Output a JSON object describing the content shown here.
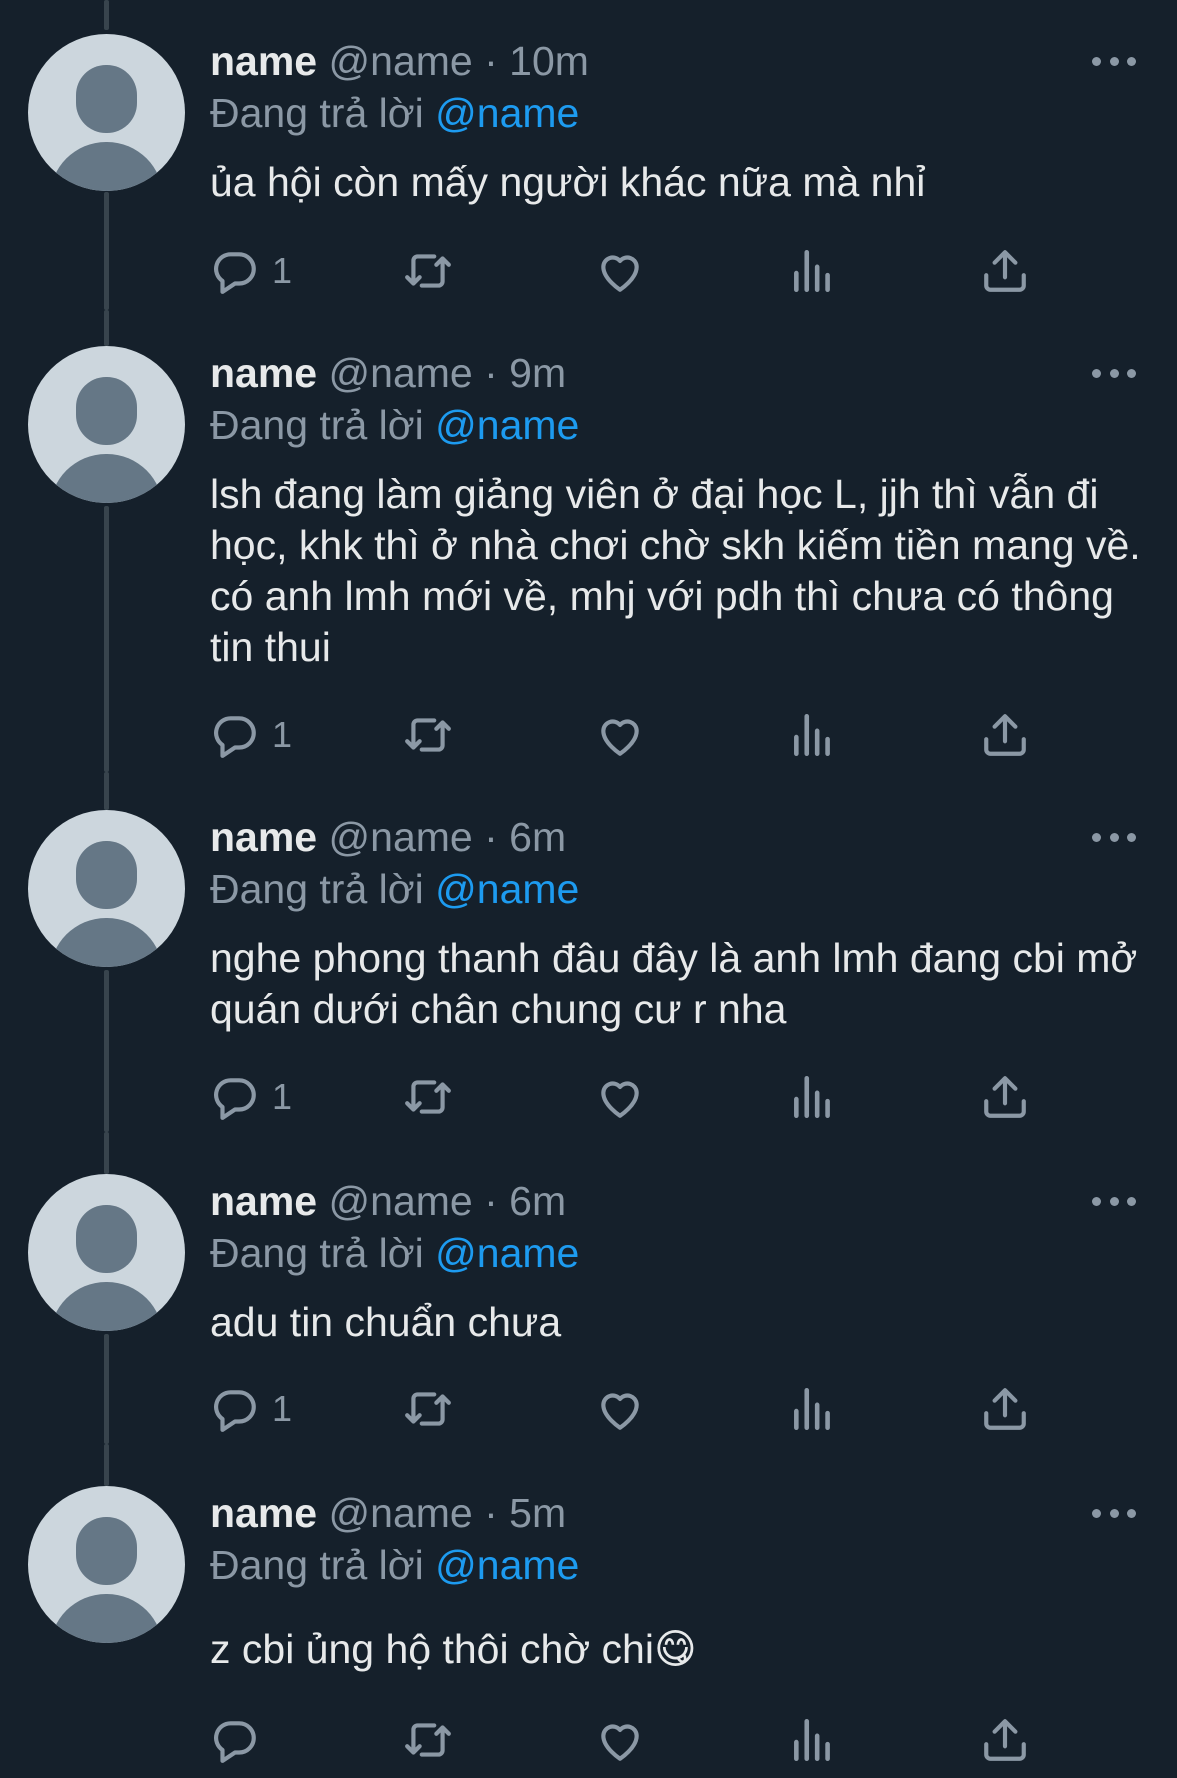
{
  "reply_prefix": "Đang trả lời",
  "tweets": [
    {
      "name": "name",
      "handle": "@name",
      "dot": "·",
      "time": "10m",
      "mention": "@name",
      "text": "ủa hội còn mấy người khác nữa mà nhỉ",
      "reply_count": "1"
    },
    {
      "name": "name",
      "handle": "@name",
      "dot": "·",
      "time": "9m",
      "mention": "@name",
      "text": "lsh đang làm giảng viên ở đại học L, jjh thì vẫn đi học, khk thì ở nhà chơi chờ skh kiếm tiền mang về. có anh lmh mới về, mhj với pdh thì chưa có thông tin thui",
      "reply_count": "1"
    },
    {
      "name": "name",
      "handle": "@name",
      "dot": "·",
      "time": "6m",
      "mention": "@name",
      "text": "nghe phong thanh đâu đây là anh lmh đang cbi mở quán dưới chân chung cư r nha",
      "reply_count": "1"
    },
    {
      "name": "name",
      "handle": "@name",
      "dot": "·",
      "time": "6m",
      "mention": "@name",
      "text": "adu tin chuẩn chưa",
      "reply_count": "1"
    },
    {
      "name": "name",
      "handle": "@name",
      "dot": "·",
      "time": "5m",
      "mention": "@name",
      "text": "z cbi ủng hộ thôi chờ chi😋",
      "reply_count": ""
    }
  ],
  "icons": {
    "reply": "reply-icon",
    "retweet": "retweet-icon",
    "like": "heart-icon",
    "views": "views-icon",
    "share": "share-icon",
    "more": "more-icon"
  },
  "colors": {
    "background": "#15202b",
    "text": "#e7e9ea",
    "secondary": "#8b98a5",
    "accent": "#1d9bf0",
    "avatar_bg": "#ccd6dd",
    "avatar_fg": "#657786"
  }
}
